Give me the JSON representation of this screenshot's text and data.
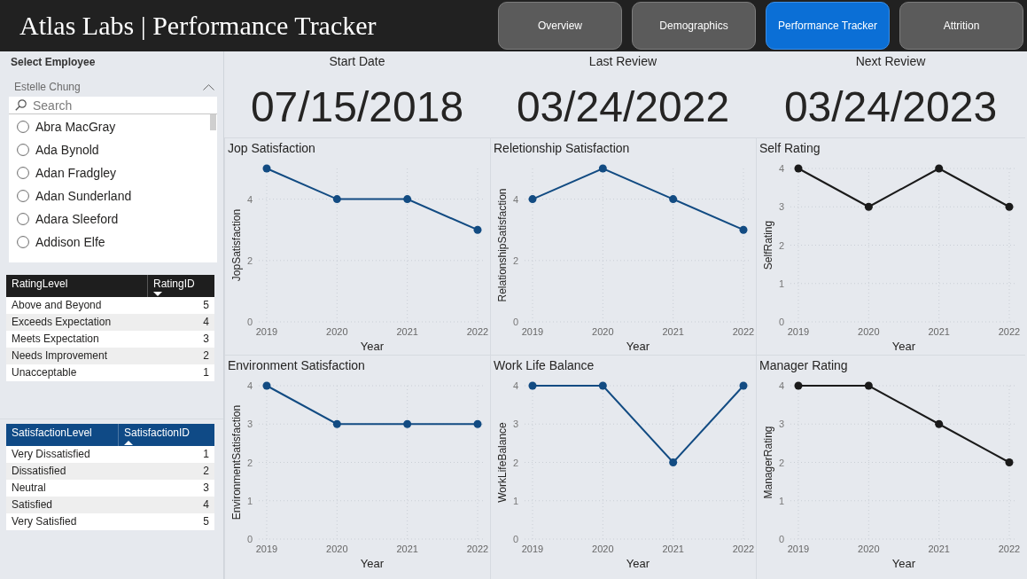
{
  "header": {
    "title": "Atlas Labs | Performance Tracker",
    "nav": [
      {
        "label": "Overview",
        "selected": false
      },
      {
        "label": "Demographics",
        "selected": false
      },
      {
        "label": "Performance Tracker",
        "selected": true
      },
      {
        "label": "Attrition",
        "selected": false
      }
    ]
  },
  "employee_slicer": {
    "title": "Select Employee",
    "value": "Estelle Chung",
    "expanded": true,
    "search": {
      "placeholder": "Search"
    },
    "items": [
      {
        "label": "Abra MacGray",
        "selected": false
      },
      {
        "label": "Ada Bynold",
        "selected": false
      },
      {
        "label": "Adan Fradgley",
        "selected": false
      },
      {
        "label": "Adan Sunderland",
        "selected": false
      },
      {
        "label": "Adara Sleeford",
        "selected": false
      },
      {
        "label": "Addison Elfe",
        "selected": false
      }
    ]
  },
  "rating_table": {
    "columns": [
      {
        "label": "RatingLevel",
        "sorted_ascending": false,
        "sorted_descending": false
      },
      {
        "label": "RatingID",
        "sorted_ascending": false,
        "sorted_descending": true
      }
    ],
    "rows": [
      [
        "Above and Beyond",
        "5"
      ],
      [
        "Exceeds Expectation",
        "4"
      ],
      [
        "Meets Expectation",
        "3"
      ],
      [
        "Needs Improvement",
        "2"
      ],
      [
        "Unacceptable",
        "1"
      ]
    ]
  },
  "satisfaction_table": {
    "columns": [
      {
        "label": "SatisfactionLevel",
        "sorted_ascending": false,
        "sorted_descending": false
      },
      {
        "label": "SatisfactionID",
        "sorted_ascending": true,
        "sorted_descending": false
      }
    ],
    "rows": [
      [
        "Very Dissatisfied",
        "1"
      ],
      [
        "Dissatisfied",
        "2"
      ],
      [
        "Neutral",
        "3"
      ],
      [
        "Satisfied",
        "4"
      ],
      [
        "Very Satisfied",
        "5"
      ]
    ]
  },
  "dates": [
    {
      "label": "Start Date",
      "value": "07/15/2018"
    },
    {
      "label": "Last Review",
      "value": "03/24/2022"
    },
    {
      "label": "Next Review",
      "value": "03/24/2023"
    }
  ],
  "charts": [
    {
      "title": "Jop Satisfaction",
      "chart_data": {
        "type": "line",
        "xlabel": "Year",
        "ylabel": "JopSatisfaction",
        "categories": [
          "2019",
          "2020",
          "2021",
          "2022"
        ],
        "series": [
          {
            "color": "#124b82",
            "marker": "circle",
            "values": [
              5,
              4,
              4,
              3
            ]
          }
        ],
        "ylim": [
          0,
          5
        ],
        "yticks": [
          0,
          2,
          4
        ],
        "grid": true
      }
    },
    {
      "title": "Reletionship Satisfaction",
      "chart_data": {
        "type": "line",
        "xlabel": "Year",
        "ylabel": "RelationshipSatisfaction",
        "categories": [
          "2019",
          "2020",
          "2021",
          "2022"
        ],
        "series": [
          {
            "color": "#124b82",
            "marker": "circle",
            "values": [
              4,
              5,
              4,
              3
            ]
          }
        ],
        "ylim": [
          0,
          5
        ],
        "yticks": [
          0,
          2,
          4
        ],
        "grid": true
      }
    },
    {
      "title": "Self Rating",
      "chart_data": {
        "type": "line",
        "xlabel": "Year",
        "ylabel": "SelfRating",
        "categories": [
          "2019",
          "2020",
          "2021",
          "2022"
        ],
        "series": [
          {
            "color": "#1a1a1a",
            "marker": "circle",
            "values": [
              4,
              3,
              4,
              3
            ]
          }
        ],
        "ylim": [
          0,
          4
        ],
        "yticks": [
          0,
          1,
          2,
          3,
          4
        ],
        "grid": true
      }
    },
    {
      "title": "Environment Satisfaction",
      "chart_data": {
        "type": "line",
        "xlabel": "Year",
        "ylabel": "EnvironmentSatisfaction",
        "categories": [
          "2019",
          "2020",
          "2021",
          "2022"
        ],
        "series": [
          {
            "color": "#124b82",
            "marker": "circle",
            "values": [
              4,
              3,
              3,
              3
            ]
          }
        ],
        "ylim": [
          0,
          4
        ],
        "yticks": [
          0,
          1,
          2,
          3,
          4
        ],
        "grid": true
      }
    },
    {
      "title": "Work Life Balance",
      "chart_data": {
        "type": "line",
        "xlabel": "Year",
        "ylabel": "WorkLifeBalance",
        "categories": [
          "2019",
          "2020",
          "2021",
          "2022"
        ],
        "series": [
          {
            "color": "#124b82",
            "marker": "circle",
            "values": [
              4,
              4,
              2,
              4
            ]
          }
        ],
        "ylim": [
          0,
          4
        ],
        "yticks": [
          0,
          1,
          2,
          3,
          4
        ],
        "grid": true
      }
    },
    {
      "title": "Manager Rating",
      "chart_data": {
        "type": "line",
        "xlabel": "Year",
        "ylabel": "ManagerRating",
        "categories": [
          "2019",
          "2020",
          "2021",
          "2022"
        ],
        "series": [
          {
            "color": "#1a1a1a",
            "marker": "circle",
            "values": [
              4,
              4,
              3,
              2
            ]
          }
        ],
        "ylim": [
          0,
          4
        ],
        "yticks": [
          0,
          1,
          2,
          3,
          4
        ],
        "grid": true
      }
    }
  ]
}
